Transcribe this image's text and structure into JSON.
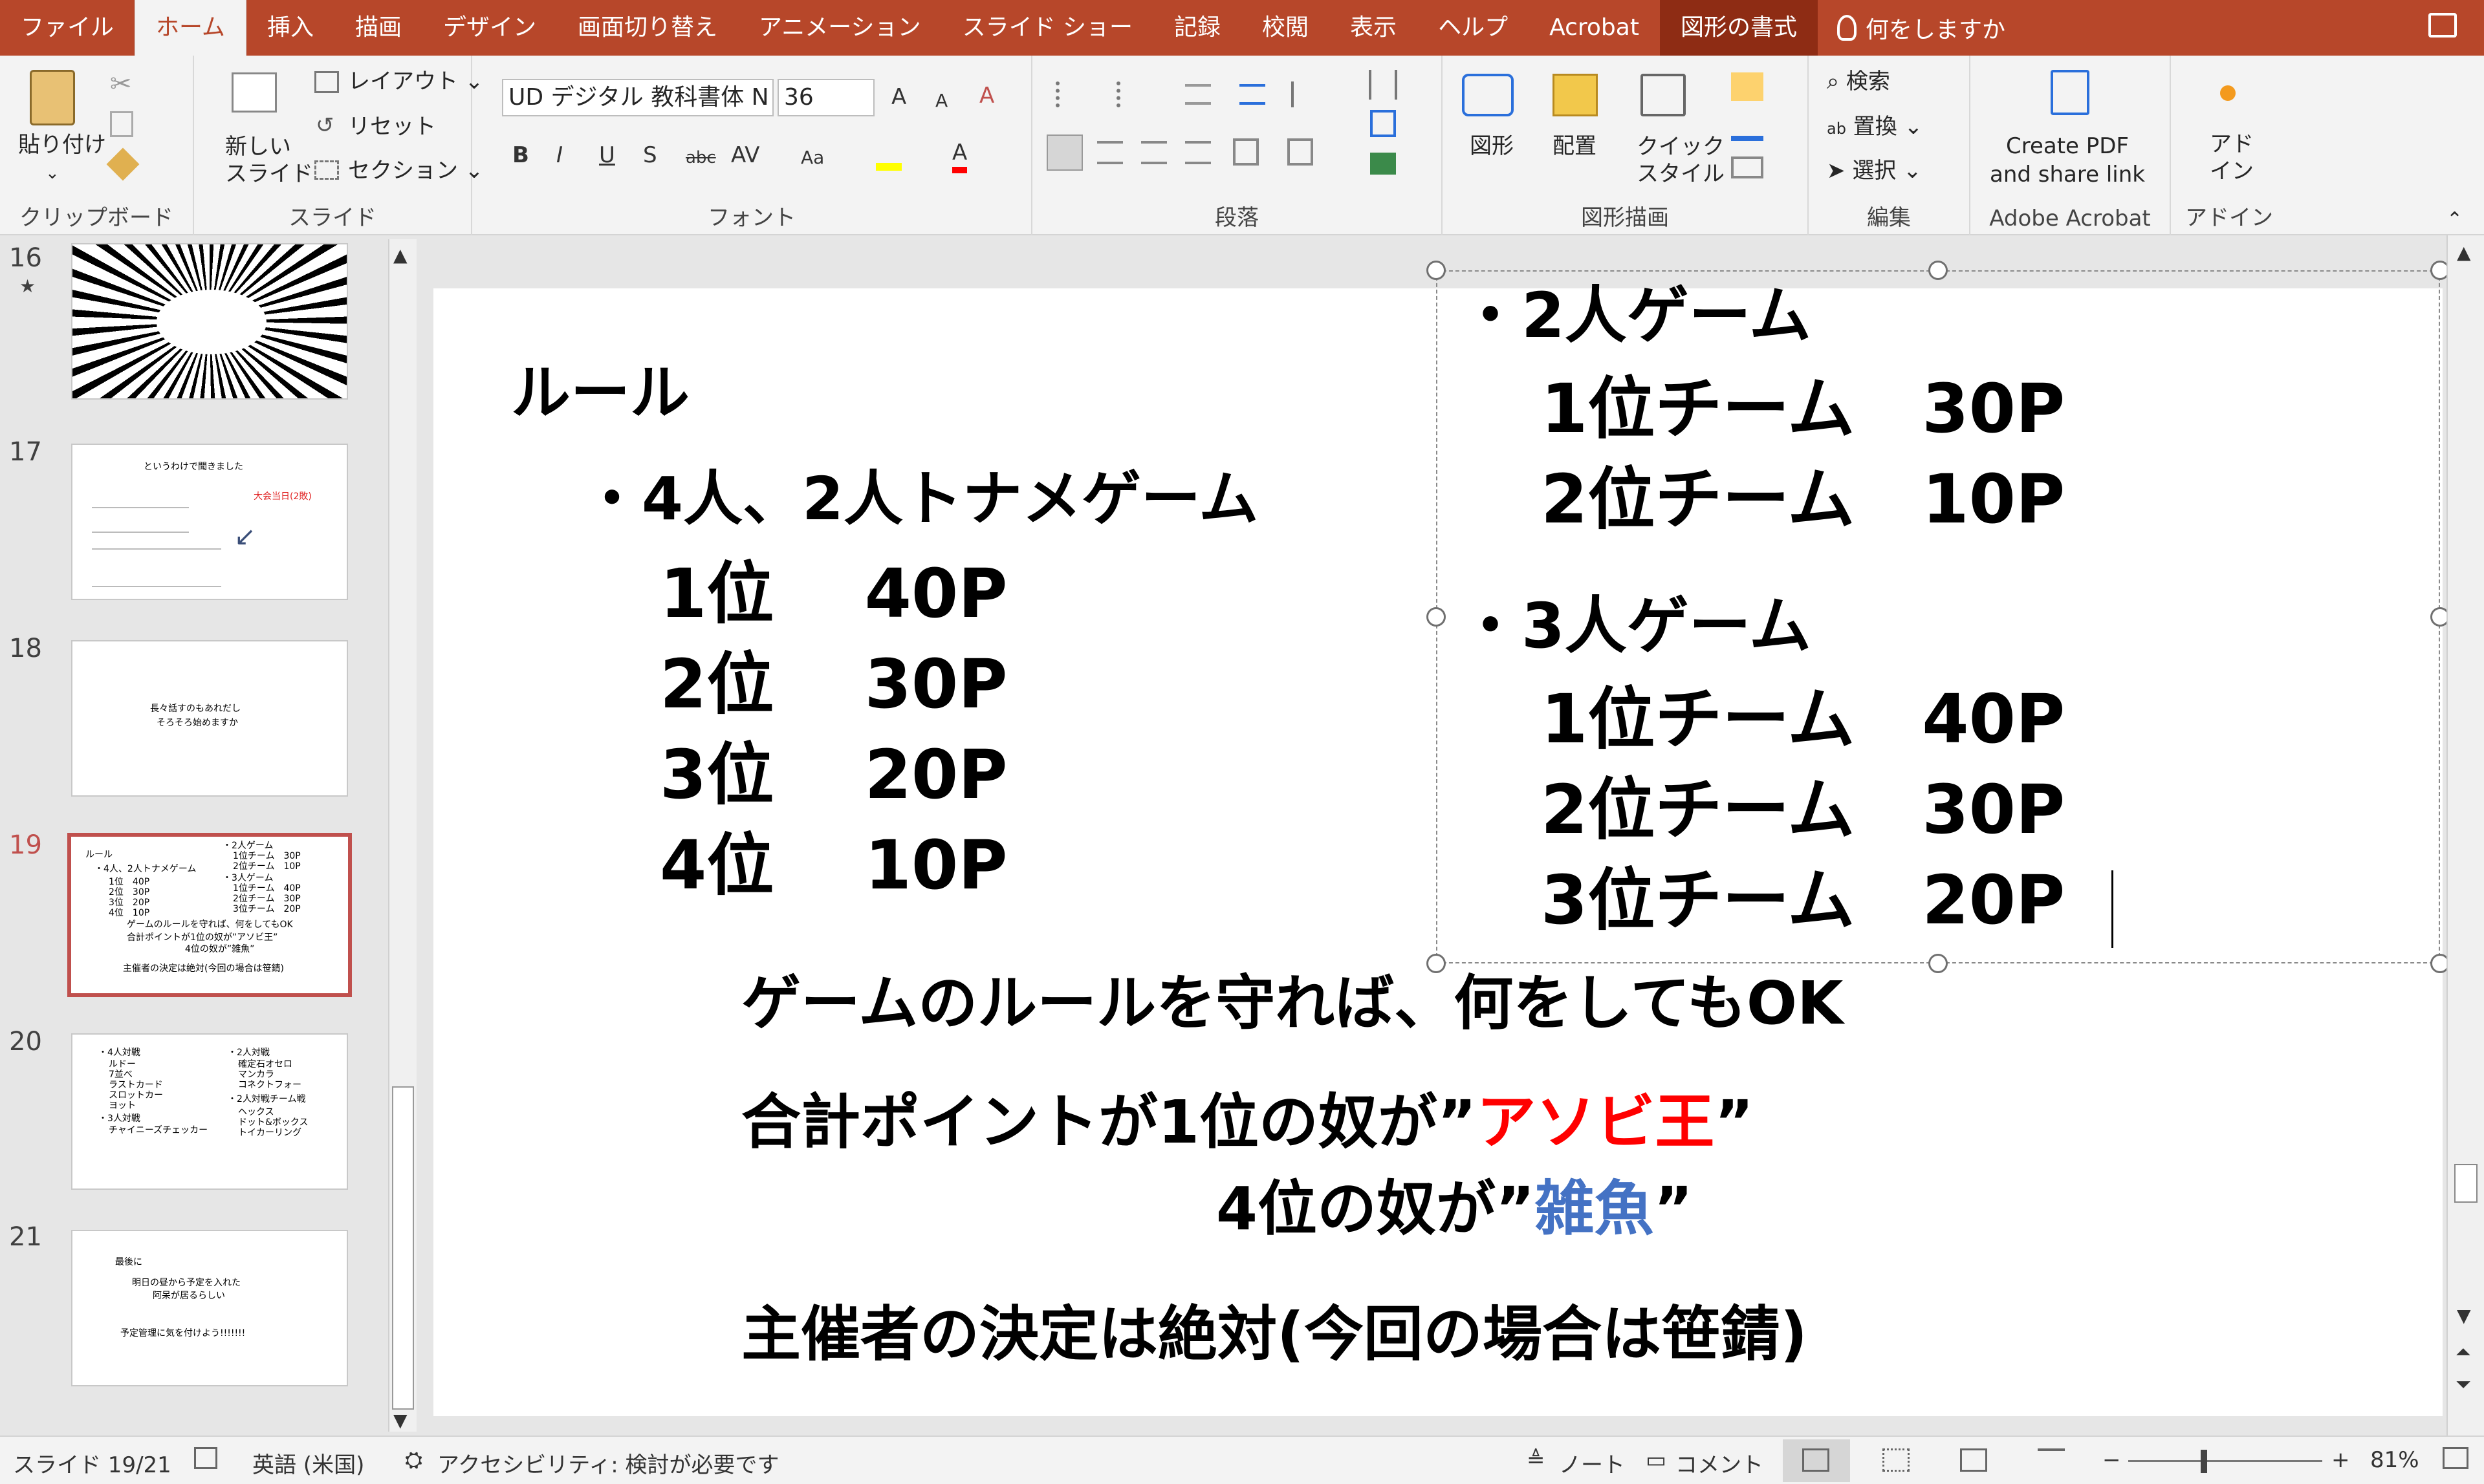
{
  "ribbon_tabs": [
    "ファイル",
    "ホーム",
    "挿入",
    "描画",
    "デザイン",
    "画面切り替え",
    "アニメーション",
    "スライド ショー",
    "記録",
    "校閲",
    "表示",
    "ヘルプ",
    "Acrobat",
    "図形の書式"
  ],
  "tell_me": "何をしますか",
  "ribbon": {
    "paste": "貼り付け",
    "new_slide": "新しい\nスライド",
    "layout": "レイアウト",
    "reset": "リセット",
    "section": "セクション",
    "font_name": "UD デジタル 教科書体 N",
    "font_size": "36",
    "shape": "図形",
    "arrange": "配置",
    "quick_style": "クイック\nスタイル",
    "find": "検索",
    "replace": "置換",
    "select": "選択",
    "create_pdf": "Create PDF\nand share link",
    "addin": "アド\nイン",
    "groups": {
      "clipboard": "クリップボード",
      "slides": "スライド",
      "font": "フォント",
      "paragraph": "段落",
      "drawing": "図形描画",
      "editing": "編集",
      "adobe": "Adobe Acrobat",
      "addins": "アドイン"
    }
  },
  "thumbnails": [
    {
      "num": "16",
      "star": "★"
    },
    {
      "num": "17",
      "lines": [
        "というわけで聞きました",
        "大会当日(2敗)"
      ]
    },
    {
      "num": "18",
      "lines": [
        "長々話すのもあれだし",
        "そろそろ始めますか"
      ]
    },
    {
      "num": "19",
      "lines": [
        "ルール",
        "・4人、2人トナメゲーム",
        "1位　40P",
        "2位　30P",
        "3位　20P",
        "4位　10P",
        "・2人ゲーム",
        "1位チーム　30P",
        "2位チーム　10P",
        "・3人ゲーム",
        "1位チーム　40P",
        "2位チーム　30P",
        "3位チーム　20P",
        "ゲームのルールを守れば、何をしてもOK",
        "合計ポイントが1位の奴が”アソビ王”",
        "4位の奴が”雑魚”",
        "主催者の決定は絶対(今回の場合は笹錆)"
      ]
    },
    {
      "num": "20",
      "lines": [
        "・4人対戦",
        "ルドー",
        "7並べ",
        "ラストカード",
        "スロットカー",
        "ヨット",
        "・3人対戦",
        "チャイニーズチェッカー",
        "・2人対戦",
        "確定石オセロ",
        "マンカラ",
        "コネクトフォー",
        "・2人対戦チーム戦",
        "ヘックス",
        "ドット&ボックス",
        "トイカーリング"
      ]
    },
    {
      "num": "21",
      "lines": [
        "最後に",
        "明日の昼から予定を入れた",
        "阿呆が居るらしい",
        "予定管理に気を付けよう!!!!!!!"
      ]
    }
  ],
  "slide": {
    "rule_title": "ルール",
    "left_heading": "・4人、2人トナメゲーム",
    "left_rows": [
      "1位　 40P",
      "2位　 30P",
      "3位　 20P",
      "4位　 10P"
    ],
    "two_heading": "・2人ゲーム",
    "two_rows": [
      "1位チーム　30P",
      "2位チーム　10P"
    ],
    "three_heading": "・3人ゲーム",
    "three_rows": [
      "1位チーム　40P",
      "2位チーム　30P",
      "3位チーム　20P"
    ],
    "line1": "ゲームのルールを守れば、何をしてもOK",
    "line2_pre": "合計ポイントが1位の奴が”",
    "line2_red": "アソビ王",
    "line2_post": "”",
    "line3_pre": "4位の奴が”",
    "line3_blue": "雑魚",
    "line3_post": "”",
    "line4": "主催者の決定は絶対(今回の場合は笹錆)"
  },
  "status": {
    "slide_pos": "スライド 19/21",
    "language": "英語 (米国)",
    "accessibility": "アクセシビリティ: 検討が必要です",
    "notes": "ノート",
    "comments": "コメント",
    "zoom": "81%"
  },
  "colors": {
    "accent": "#b7472a",
    "red": "#ff0000",
    "blue": "#4472c4"
  }
}
